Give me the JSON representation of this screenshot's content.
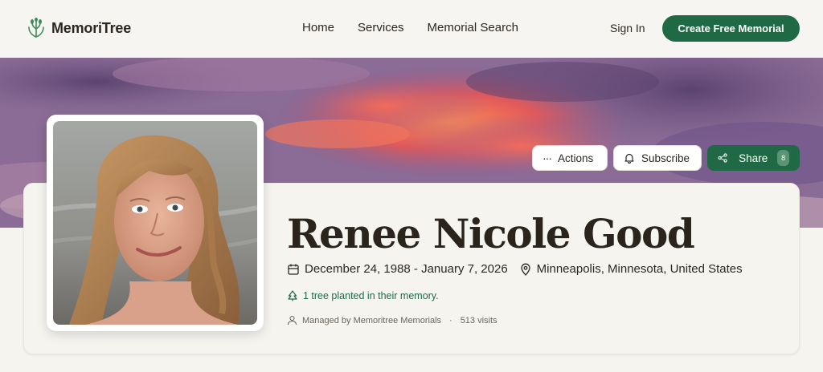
{
  "brand": {
    "name": "MemoriTree",
    "logo_icon": "tree-hands-icon"
  },
  "nav": {
    "items": [
      "Home",
      "Services",
      "Memorial Search"
    ]
  },
  "header": {
    "signin_label": "Sign In",
    "cta_label": "Create Free Memorial"
  },
  "colors": {
    "primary": "#1f6a45",
    "background": "#f6f4ef",
    "text": "#2b2620"
  },
  "actions": {
    "actions_label": "Actions",
    "subscribe_label": "Subscribe",
    "share_label": "Share",
    "share_count": "8"
  },
  "memorial": {
    "name": "Renee Nicole Good",
    "dates": "December 24, 1988 - January 7, 2026",
    "location": "Minneapolis, Minnesota, United States",
    "trees": "1 tree planted in their memory.",
    "managed_by": "Managed by Memoritree Memorials",
    "visits": "513 visits"
  }
}
